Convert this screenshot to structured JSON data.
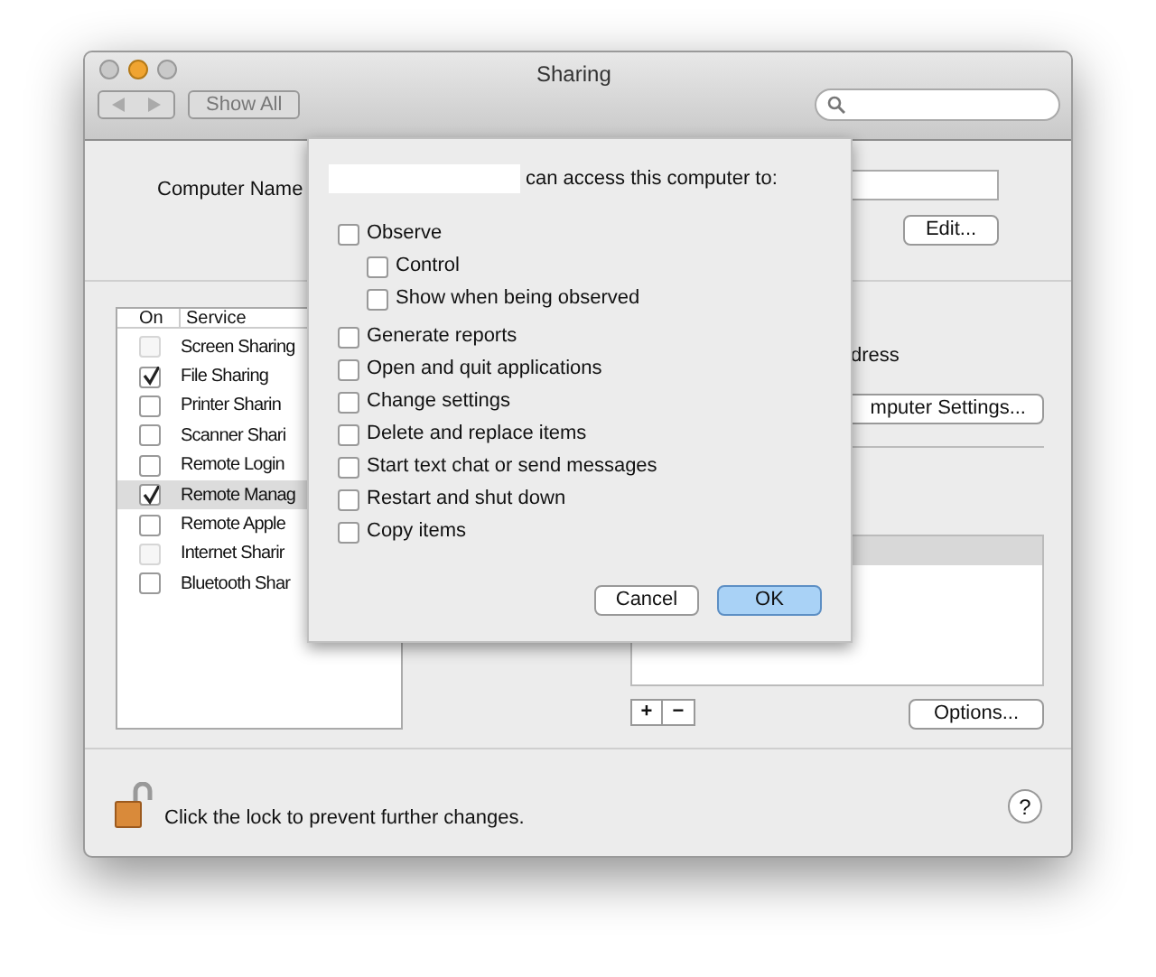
{
  "window": {
    "title": "Sharing"
  },
  "toolbar": {
    "show_all": "Show All"
  },
  "computer_name": {
    "label": "Computer Name",
    "edit_button": "Edit..."
  },
  "services": {
    "columns": [
      "On",
      "Service"
    ],
    "items": [
      {
        "label": "Screen Sharing",
        "checked": false,
        "disabled": true,
        "selected": false
      },
      {
        "label": "File Sharing",
        "checked": true,
        "disabled": false,
        "selected": false
      },
      {
        "label": "Printer Sharin",
        "checked": false,
        "disabled": false,
        "selected": false
      },
      {
        "label": "Scanner Shari",
        "checked": false,
        "disabled": false,
        "selected": false
      },
      {
        "label": "Remote Login",
        "checked": false,
        "disabled": false,
        "selected": false
      },
      {
        "label": "Remote Manag",
        "checked": true,
        "disabled": false,
        "selected": true
      },
      {
        "label": "Remote Apple",
        "checked": false,
        "disabled": false,
        "selected": false
      },
      {
        "label": "Internet Sharir",
        "checked": false,
        "disabled": true,
        "selected": false
      },
      {
        "label": "Bluetooth Shar",
        "checked": false,
        "disabled": false,
        "selected": false
      }
    ]
  },
  "detail": {
    "address_fragment": "dress",
    "settings_button": "mputer Settings...",
    "add": "+",
    "remove": "−",
    "options_button": "Options..."
  },
  "sheet": {
    "heading": "can access this computer to:",
    "options": [
      {
        "label": "Observe",
        "checked": false,
        "children": [
          {
            "label": "Control",
            "checked": false
          },
          {
            "label": "Show when being observed",
            "checked": false
          }
        ]
      },
      {
        "label": "Generate reports",
        "checked": false
      },
      {
        "label": "Open and quit applications",
        "checked": false
      },
      {
        "label": "Change settings",
        "checked": false
      },
      {
        "label": "Delete and replace items",
        "checked": false
      },
      {
        "label": "Start text chat or send messages",
        "checked": false
      },
      {
        "label": "Restart and shut down",
        "checked": false
      },
      {
        "label": "Copy items",
        "checked": false
      }
    ],
    "buttons": [
      {
        "label": "Cancel",
        "default": false
      },
      {
        "label": "OK",
        "default": true
      }
    ]
  },
  "footer": {
    "lock_text": "Click the lock to prevent further changes.",
    "help": "?"
  }
}
